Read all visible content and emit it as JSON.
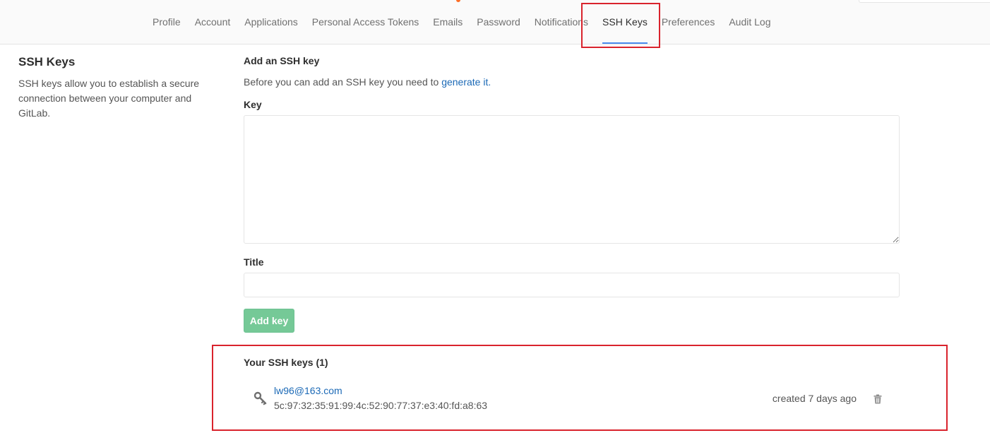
{
  "nav": {
    "tabs": [
      {
        "label": "Profile",
        "active": false
      },
      {
        "label": "Account",
        "active": false
      },
      {
        "label": "Applications",
        "active": false
      },
      {
        "label": "Personal Access Tokens",
        "active": false
      },
      {
        "label": "Emails",
        "active": false
      },
      {
        "label": "Password",
        "active": false
      },
      {
        "label": "Notifications",
        "active": false
      },
      {
        "label": "SSH Keys",
        "active": true
      },
      {
        "label": "Preferences",
        "active": false
      },
      {
        "label": "Audit Log",
        "active": false
      }
    ]
  },
  "sidebar": {
    "title": "SSH Keys",
    "description": "SSH keys allow you to establish a secure connection between your computer and GitLab."
  },
  "form": {
    "heading": "Add an SSH key",
    "hint_prefix": "Before you can add an SSH key you need to ",
    "hint_link": "generate it.",
    "key_label": "Key",
    "key_value": "",
    "title_label": "Title",
    "title_value": "",
    "submit_label": "Add key"
  },
  "keys": {
    "heading": "Your SSH keys (1)",
    "items": [
      {
        "name": "lw96@163.com",
        "fingerprint": "5c:97:32:35:91:99:4c:52:90:77:37:e3:40:fd:a8:63",
        "created": "created 7 days ago"
      }
    ]
  },
  "colors": {
    "accent": "#4a8bee",
    "link": "#1b69b6",
    "add_button": "#75c997",
    "annotation_box": "#d9232d"
  }
}
